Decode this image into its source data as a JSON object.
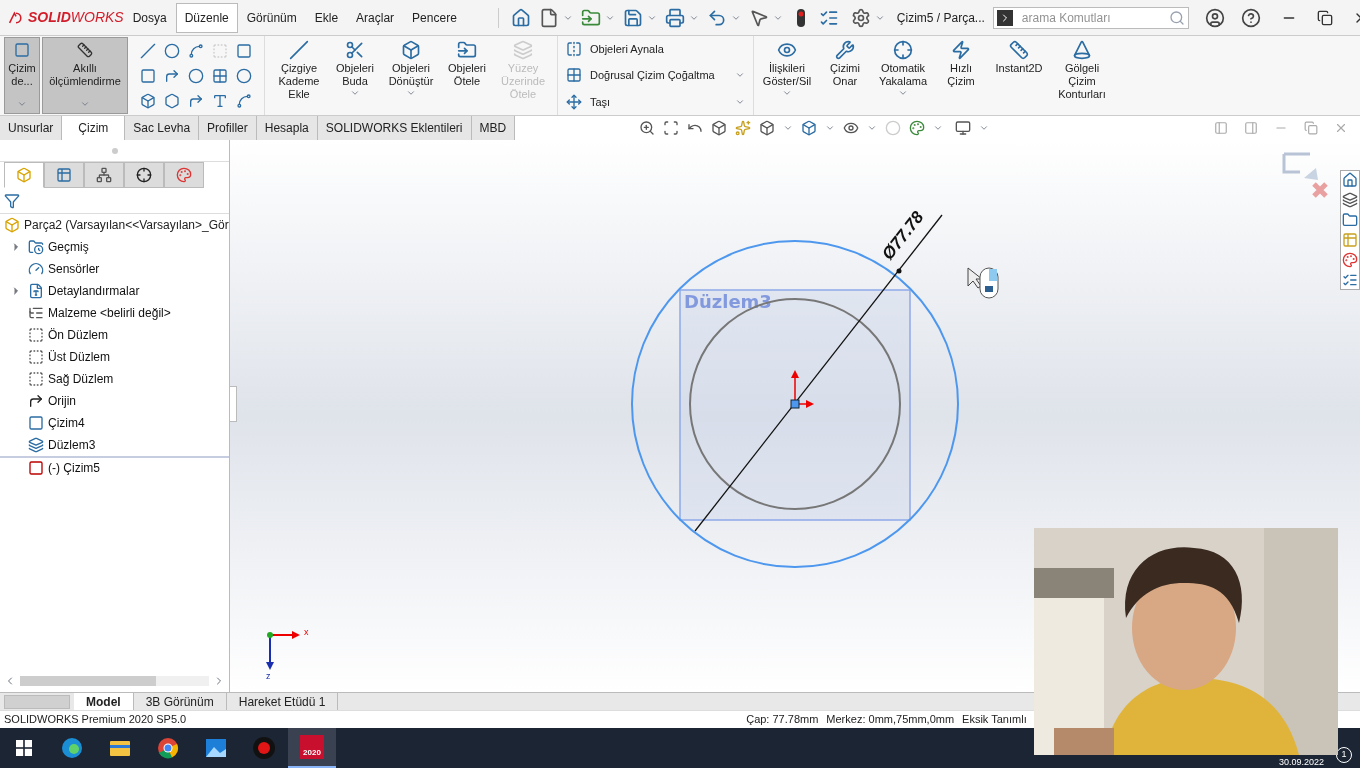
{
  "app": {
    "logo_bold": "SOLID",
    "logo_light": "WORKS"
  },
  "menu": [
    {
      "label": "Dosya",
      "selected": false
    },
    {
      "label": "Düzenle",
      "selected": true
    },
    {
      "label": "Görünüm",
      "selected": false
    },
    {
      "label": "Ekle",
      "selected": false
    },
    {
      "label": "Araçlar",
      "selected": false
    },
    {
      "label": "Pencere",
      "selected": false
    }
  ],
  "title": "Çizim5 / Parça...",
  "search": {
    "placeholder": "arama Komutları"
  },
  "ribbon": {
    "sketch_buttons": [
      {
        "label": "Çizim de...",
        "pressed": true
      },
      {
        "label": "Akıllı ölçümlendirme",
        "pressed": true
      }
    ],
    "commands": [
      {
        "label": "Çizgiye Kademe Ekle",
        "disabled": false,
        "dropdown": false
      },
      {
        "label": "Objeleri Buda",
        "disabled": false,
        "dropdown": true
      },
      {
        "label": "Objeleri Dönüştür",
        "disabled": false,
        "dropdown": true
      },
      {
        "label": "Objeleri Ötele",
        "disabled": false,
        "dropdown": false
      },
      {
        "label": "Yüzey Üzerinde Ötele",
        "disabled": true,
        "dropdown": false
      }
    ],
    "list_commands": [
      {
        "label": "Objeleri Aynala",
        "dropdown": false
      },
      {
        "label": "Doğrusal Çizim Çoğaltma",
        "dropdown": true
      },
      {
        "label": "Taşı",
        "dropdown": true
      }
    ],
    "tools": [
      {
        "label": "İlişkileri Göster/Sil",
        "dropdown": true
      },
      {
        "label": "Çizimi Onar",
        "dropdown": false
      },
      {
        "label": "Otomatik Yakalama",
        "dropdown": true
      },
      {
        "label": "Hızlı Çizim",
        "dropdown": false
      },
      {
        "label": "Instant2D",
        "dropdown": false
      },
      {
        "label": "Gölgeli Çizim Konturları",
        "dropdown": false
      }
    ]
  },
  "command_tabs": [
    {
      "label": "Unsurlar",
      "selected": false
    },
    {
      "label": "Çizim",
      "selected": true
    },
    {
      "label": "Sac Levha",
      "selected": false
    },
    {
      "label": "Profiller",
      "selected": false
    },
    {
      "label": "Hesapla",
      "selected": false
    },
    {
      "label": "SOLIDWORKS Eklentileri",
      "selected": false
    },
    {
      "label": "MBD",
      "selected": false
    }
  ],
  "panel_tabs": [
    {
      "selected": true
    },
    {
      "selected": false
    },
    {
      "selected": false
    },
    {
      "selected": false
    },
    {
      "selected": false
    }
  ],
  "feature_tree": {
    "label": "Parça2  (Varsayılan<<Varsayılan>_Gör",
    "children": [
      {
        "label": "Geçmiş",
        "kind": "history",
        "expanded": false
      },
      {
        "label": "Sensörler",
        "kind": "sensors"
      },
      {
        "label": "Detaylandırmalar",
        "kind": "annotations",
        "expanded": false
      },
      {
        "label": "Malzeme <belirli değil>",
        "kind": "material"
      },
      {
        "label": "Ön Düzlem",
        "kind": "plane"
      },
      {
        "label": "Üst Düzlem",
        "kind": "plane"
      },
      {
        "label": "Sağ Düzlem",
        "kind": "plane"
      },
      {
        "label": "Orijin",
        "kind": "origin"
      },
      {
        "label": "Çizim4",
        "kind": "sketch"
      },
      {
        "label": "Düzlem3",
        "kind": "refplane"
      },
      {
        "label": "(-) Çizim5",
        "kind": "editing"
      }
    ]
  },
  "viewport": {
    "plane_label": "Düzlem3",
    "dimension": "Ø77.78",
    "triad": [
      "x",
      "z"
    ]
  },
  "sheet_tabs": [
    {
      "label": "Model",
      "selected": true
    },
    {
      "label": "3B Görünüm",
      "selected": false
    },
    {
      "label": "Hareket Etüdü 1",
      "selected": false
    }
  ],
  "status": {
    "product": "SOLIDWORKS Premium 2020 SP5.0",
    "readouts": [
      "Çap: 77.78mm",
      "Merkez: 0mm,75mm,0mm",
      "Eksik Tanımlı"
    ]
  },
  "taskbar": {
    "apps": [
      {
        "kind": "edge",
        "selected": false
      },
      {
        "kind": "explorer",
        "selected": false
      },
      {
        "kind": "chrome",
        "selected": false
      },
      {
        "kind": "photos",
        "selected": false
      },
      {
        "kind": "recorder",
        "selected": false
      },
      {
        "kind": "solidworks",
        "selected": true
      }
    ],
    "solidworks_badge": "2020",
    "date": "30.09.2022",
    "notifications": "1"
  }
}
